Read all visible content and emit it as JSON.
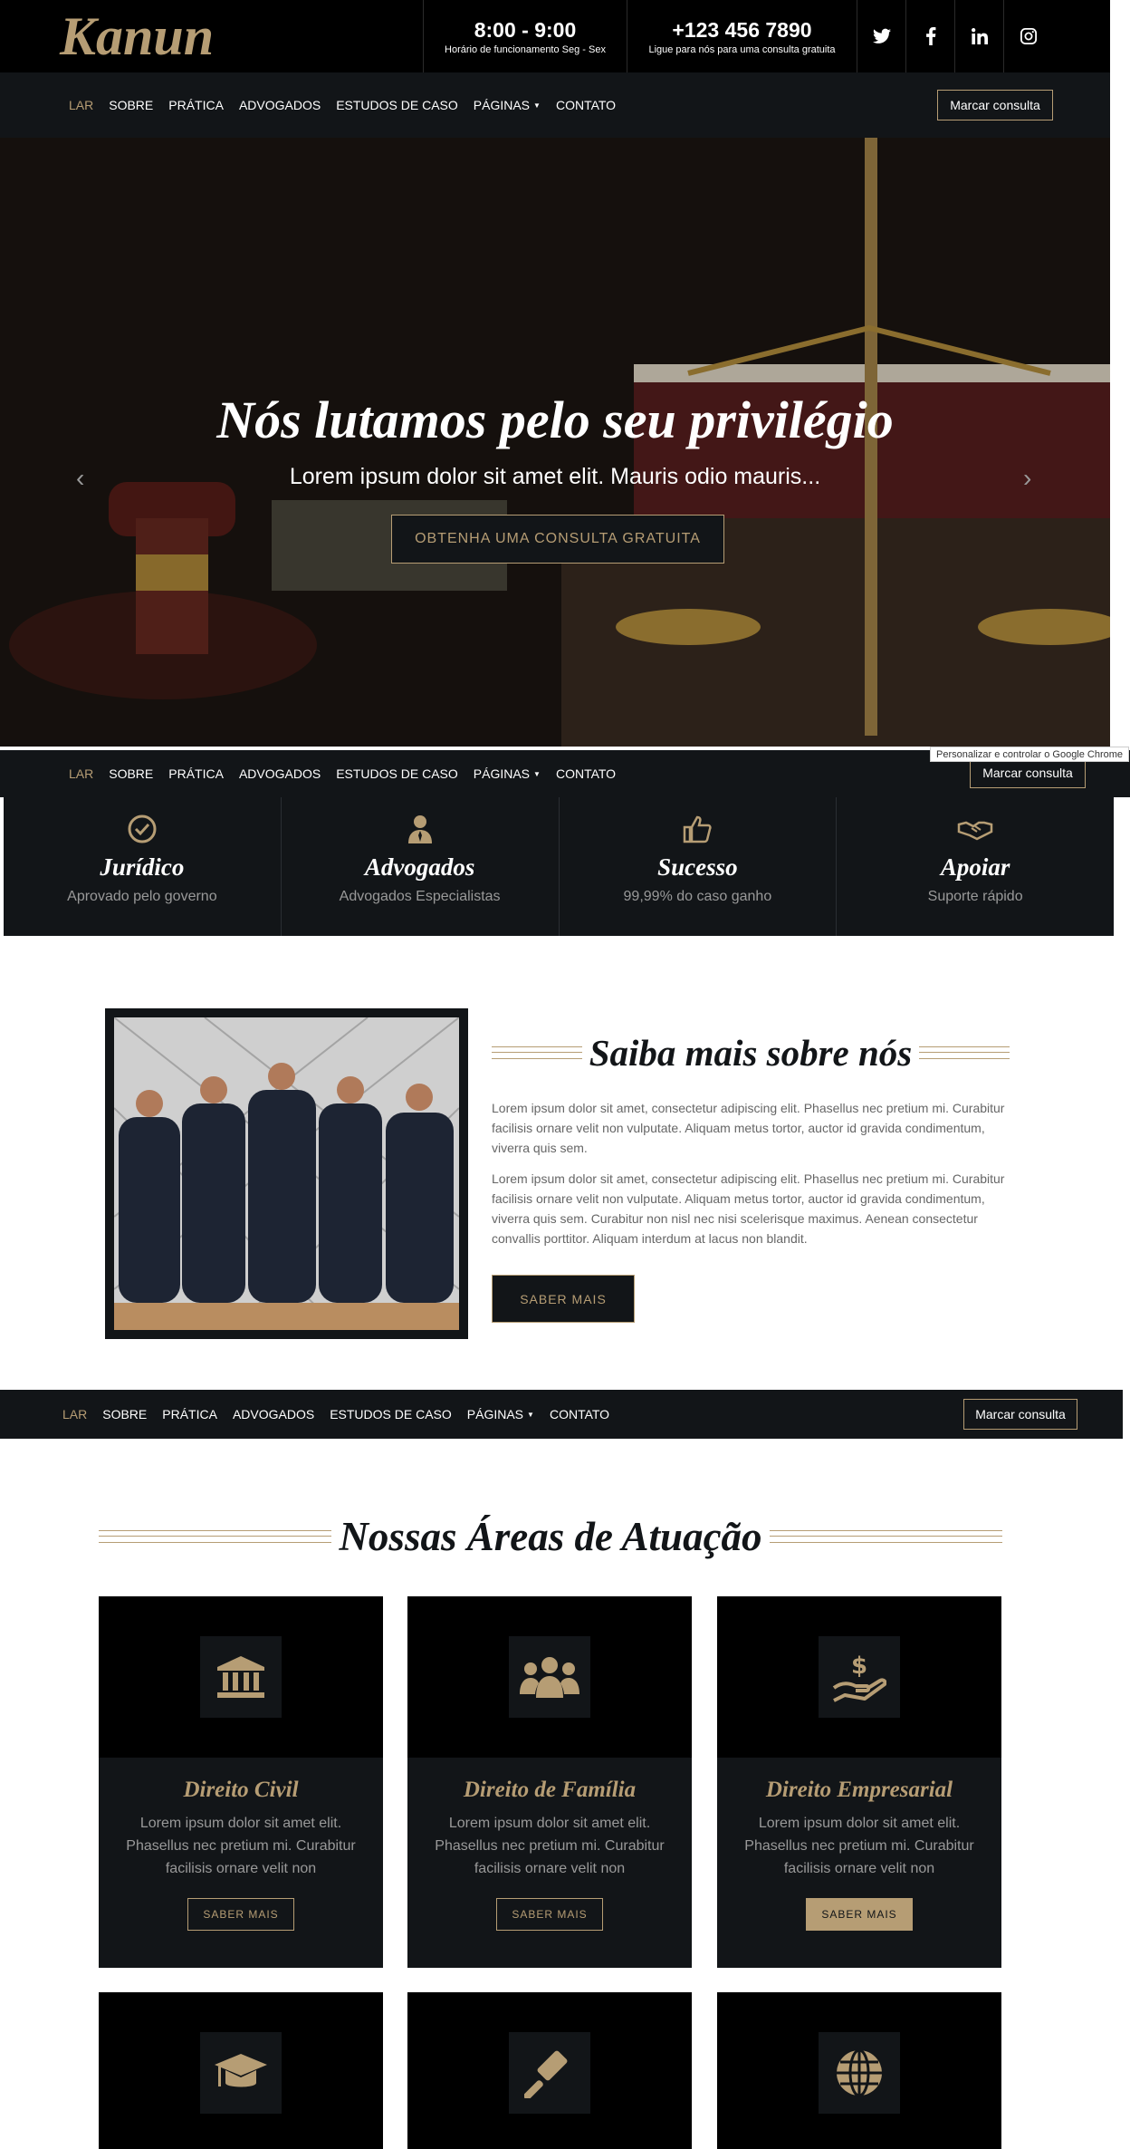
{
  "brand": {
    "logo": "Kanun",
    "accent": "#b69d74",
    "dark": "#121518"
  },
  "topbar": {
    "hours": {
      "value": "8:00 - 9:00",
      "label": "Horário de funcionamento Seg - Sex"
    },
    "phone": {
      "value": "+123 456 7890",
      "label": "Ligue para nós para uma consulta gratuita"
    },
    "social": [
      "twitter-icon",
      "facebook-icon",
      "linkedin-icon",
      "instagram-icon"
    ]
  },
  "nav": {
    "items": [
      {
        "label": "LAR",
        "active": true
      },
      {
        "label": "SOBRE"
      },
      {
        "label": "PRÁTICA"
      },
      {
        "label": "ADVOGADOS"
      },
      {
        "label": "ESTUDOS DE CASO"
      },
      {
        "label": "PÁGINAS",
        "dropdown": true
      },
      {
        "label": "CONTATO"
      }
    ],
    "cta": "Marcar consulta"
  },
  "hero": {
    "title": "Nós lutamos pelo seu privilégio",
    "subtitle": "Lorem ipsum dolor sit amet elit. Mauris odio mauris...",
    "button": "OBTENHA UMA CONSULTA GRATUITA"
  },
  "tooltip": "Personalizar e controlar o Google Chrome",
  "features": [
    {
      "icon": "check-circle-icon",
      "title": "Jurídico",
      "desc": "Aprovado pelo governo"
    },
    {
      "icon": "lawyer-icon",
      "title": "Advogados",
      "desc": "Advogados Especialistas"
    },
    {
      "icon": "thumbs-up-icon",
      "title": "Sucesso",
      "desc": "99,99% do caso ganho"
    },
    {
      "icon": "handshake-icon",
      "title": "Apoiar",
      "desc": "Suporte rápido"
    }
  ],
  "about": {
    "title": "Saiba mais sobre nós",
    "p1": "Lorem ipsum dolor sit amet, consectetur adipiscing elit. Phasellus nec pretium mi. Curabitur facilisis ornare velit non vulputate. Aliquam metus tortor, auctor id gravida condimentum, viverra quis sem.",
    "p2": "Lorem ipsum dolor sit amet, consectetur adipiscing elit. Phasellus nec pretium mi. Curabitur facilisis ornare velit non vulputate. Aliquam metus tortor, auctor id gravida condimentum, viverra quis sem. Curabitur non nisl nec nisi scelerisque maximus. Aenean consectetur convallis porttitor. Aliquam interdum at lacus non blandit.",
    "button": "SABER MAIS"
  },
  "practice": {
    "title": "Nossas Áreas de Atuação",
    "cards": [
      {
        "icon": "bank-icon",
        "title": "Direito Civil",
        "desc": "Lorem ipsum dolor sit amet elit. Phasellus nec pretium mi. Curabitur facilisis ornare velit non",
        "button": "SABER MAIS"
      },
      {
        "icon": "family-icon",
        "title": "Direito de Família",
        "desc": "Lorem ipsum dolor sit amet elit. Phasellus nec pretium mi. Curabitur facilisis ornare velit non",
        "button": "SABER MAIS"
      },
      {
        "icon": "business-money-icon",
        "title": "Direito Empresarial",
        "desc": "Lorem ipsum dolor sit amet elit. Phasellus nec pretium mi. Curabitur facilisis ornare velit non",
        "button": "SABER MAIS"
      },
      {
        "icon": "graduation-cap-icon"
      },
      {
        "icon": "gavel-icon"
      },
      {
        "icon": "globe-icon"
      }
    ]
  }
}
